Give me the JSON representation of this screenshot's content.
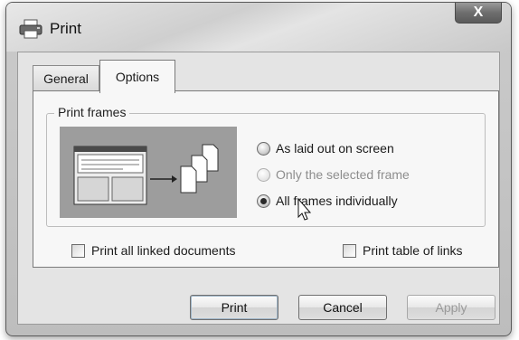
{
  "window": {
    "title": "Print",
    "close_label": "X"
  },
  "tabs": [
    {
      "label": "General",
      "selected": false
    },
    {
      "label": "Options",
      "selected": true
    }
  ],
  "print_frames": {
    "group_label": "Print frames",
    "options": [
      {
        "label": "As laid out on screen",
        "checked": false,
        "enabled": true
      },
      {
        "label": "Only the selected frame",
        "checked": false,
        "enabled": false
      },
      {
        "label": "All frames individually",
        "checked": true,
        "enabled": true
      }
    ]
  },
  "checkboxes": {
    "linked_documents": {
      "label": "Print all linked documents",
      "checked": false
    },
    "table_of_links": {
      "label": "Print table of links",
      "checked": false
    }
  },
  "buttons": {
    "print": "Print",
    "cancel": "Cancel",
    "apply": "Apply"
  }
}
